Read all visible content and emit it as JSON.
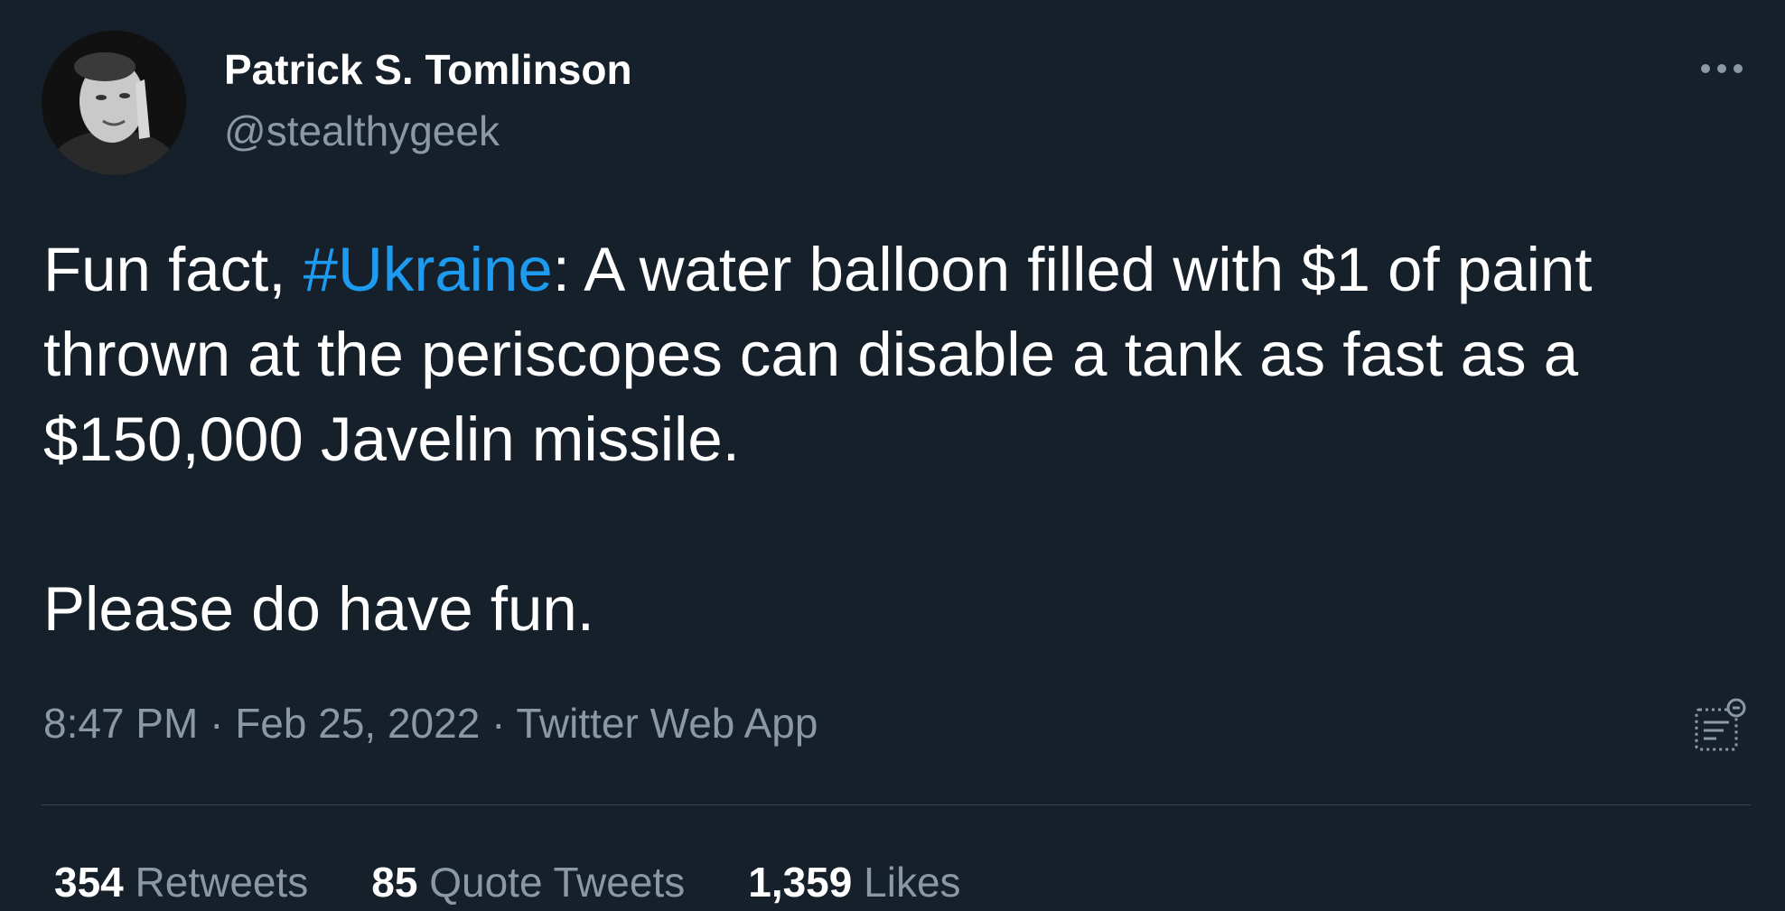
{
  "author": {
    "name": "Patrick S. Tomlinson",
    "handle": "@stealthygeek"
  },
  "tweet": {
    "text_before_hashtag": "Fun fact, ",
    "hashtag": "#Ukraine",
    "text_after_hashtag": ": A water balloon filled with $1 of paint thrown at the periscopes can disable a tank as fast as a $150,000 Javelin missile.",
    "paragraph2": "Please do have fun."
  },
  "meta": {
    "time": "8:47 PM",
    "separator": " · ",
    "date": "Feb 25, 2022",
    "source": "Twitter Web App"
  },
  "stats": {
    "retweets_count": "354",
    "retweets_label": "Retweets",
    "quotes_count": "85",
    "quotes_label": "Quote Tweets",
    "likes_count": "1,359",
    "likes_label": "Likes"
  },
  "icons": {
    "more": "more-horizontal-icon",
    "analytics": "analytics-icon"
  },
  "colors": {
    "background": "#15202b",
    "text": "#ffffff",
    "secondary": "#8b98a5",
    "accent": "#1d9bf0",
    "divider": "#38444d"
  }
}
